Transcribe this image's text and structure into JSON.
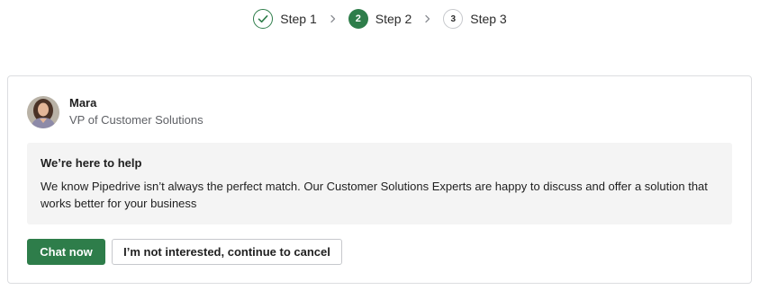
{
  "stepper": {
    "steps": [
      {
        "number": "1",
        "label": "Step 1",
        "state": "completed",
        "icon": "check-icon"
      },
      {
        "number": "2",
        "label": "Step 2",
        "state": "active"
      },
      {
        "number": "3",
        "label": "Step 3",
        "state": "pending"
      }
    ],
    "separator_icon": "chevron-right-icon"
  },
  "profile": {
    "name": "Mara",
    "title": "VP of Customer Solutions",
    "avatar_icon": "avatar"
  },
  "help": {
    "heading": "We’re here to help",
    "body": "We know Pipedrive isn’t always the perfect match. Our Customer Solutions Experts are happy to discuss and offer a solution that works better for your business"
  },
  "actions": {
    "primary_label": "Chat now",
    "secondary_label": "I’m not interested, continue to cancel"
  },
  "colors": {
    "accent": "#2e7d4a",
    "help_background": "#f4f4f4",
    "border": "#dcdde0"
  }
}
